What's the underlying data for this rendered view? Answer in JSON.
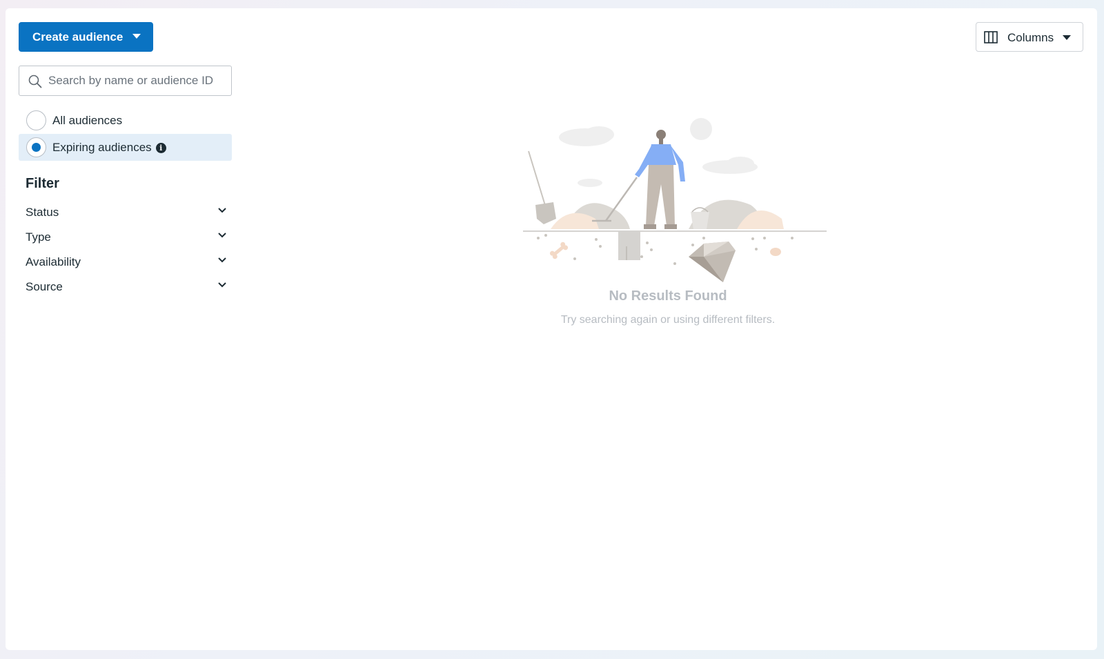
{
  "toolbar": {
    "create_label": "Create audience",
    "columns_label": "Columns"
  },
  "search": {
    "placeholder": "Search by name or audience ID",
    "value": ""
  },
  "audience_options": [
    {
      "label": "All audiences",
      "selected": false
    },
    {
      "label": "Expiring audiences",
      "selected": true
    }
  ],
  "filter": {
    "title": "Filter",
    "items": [
      {
        "label": "Status"
      },
      {
        "label": "Type"
      },
      {
        "label": "Availability"
      },
      {
        "label": "Source"
      }
    ]
  },
  "empty_state": {
    "title": "No Results Found",
    "subtitle": "Try searching again or using different filters."
  },
  "colors": {
    "primary": "#0a73c2",
    "selected_bg": "#e3eef8",
    "text": "#1c2b33",
    "muted": "#b7bcc2"
  },
  "icons": [
    "caret-down-icon",
    "columns-icon",
    "search-icon",
    "info-icon",
    "chevron-down-icon"
  ]
}
